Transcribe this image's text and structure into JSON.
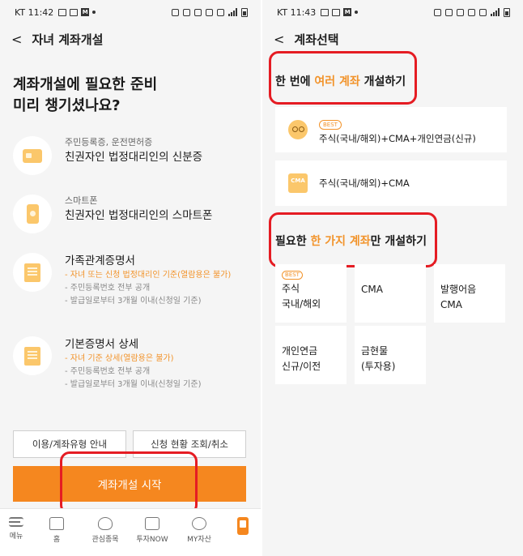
{
  "left": {
    "status": {
      "time": "KT 11:42"
    },
    "header": {
      "back": "<",
      "title": "자녀 계좌개설"
    },
    "intro": {
      "line1": "계좌개설에 필요한 준비",
      "line2": "미리 챙기셨나요?"
    },
    "docs": [
      {
        "icon": "id-card-icon",
        "sub": "주민등록증, 운전면허증",
        "main": "친권자인 법정대리인의 신분증",
        "notes": []
      },
      {
        "icon": "smartphone-icon",
        "sub": "스마트폰",
        "main": "친권자인 법정대리인의 스마트폰",
        "notes": []
      },
      {
        "icon": "document-icon",
        "sub": "",
        "main": "가족관계증명서",
        "notes": [
          {
            "text": "- 자녀 또는 신청 법정대리인 기준(열람용은 불가)",
            "highlight": true
          },
          {
            "text": "- 주민등록번호 전부 공개",
            "highlight": false
          },
          {
            "text": "- 발급일로부터 3개월 이내(신청일 기준)",
            "highlight": false
          }
        ]
      },
      {
        "icon": "document-icon",
        "sub": "",
        "main": "기본증명서 상세",
        "notes": [
          {
            "text": "- 자녀 기준 상세(열람용은 불가)",
            "highlight": true
          },
          {
            "text": "- 주민등록번호 전부 공개",
            "highlight": false
          },
          {
            "text": "- 발급일로부터 3개월 이내(신청일 기준)",
            "highlight": false
          }
        ]
      }
    ],
    "buttons": {
      "usage_guide": "이용/계좌유형 안내",
      "status_lookup": "신청 현황 조회/취소",
      "start": "계좌개설 시작"
    },
    "tabbar": [
      {
        "icon": "menu-icon",
        "label": "메뉴"
      },
      {
        "icon": "home-icon",
        "label": "홈"
      },
      {
        "icon": "heart-icon",
        "label": "관심종목"
      },
      {
        "icon": "monitor-icon",
        "label": "투자NOW"
      },
      {
        "icon": "pie-chart-icon",
        "label": "MY자산"
      },
      {
        "icon": "app-icon",
        "label": ""
      }
    ]
  },
  "right": {
    "status": {
      "time": "KT 11:43"
    },
    "header": {
      "back": "<",
      "title": "계좌선택"
    },
    "section1": {
      "pre": "한 번에 ",
      "highlight": "여러 계좌",
      "post": " 개설하기"
    },
    "bundles": [
      {
        "badge": "BEST",
        "label": "주식(국내/해외)+CMA+개인연금(신규)",
        "icon": "face-icon"
      },
      {
        "badge": "",
        "label": "주식(국내/해외)+CMA",
        "icon": "cma-icon",
        "icon_text": "CMA"
      }
    ],
    "section2": {
      "pre": "필요한 ",
      "highlight": "한 가지 계좌",
      "post": "만 개설하기"
    },
    "singles": [
      {
        "badge": "BEST",
        "line1": "주식",
        "line2": "국내/해외"
      },
      {
        "badge": "",
        "line1": "CMA",
        "line2": ""
      },
      {
        "badge": "",
        "line1": "발행어음",
        "line2": "CMA"
      },
      {
        "badge": "",
        "line1": "개인연금",
        "line2": "신규/이전"
      },
      {
        "badge": "",
        "line1": "금현물",
        "line2": "(투자용)"
      }
    ]
  },
  "colors": {
    "accent": "#f5871f",
    "highlight_text": "#f2932a",
    "annotation_red": "#e51c23",
    "icon_yellow": "#fbc76b"
  }
}
